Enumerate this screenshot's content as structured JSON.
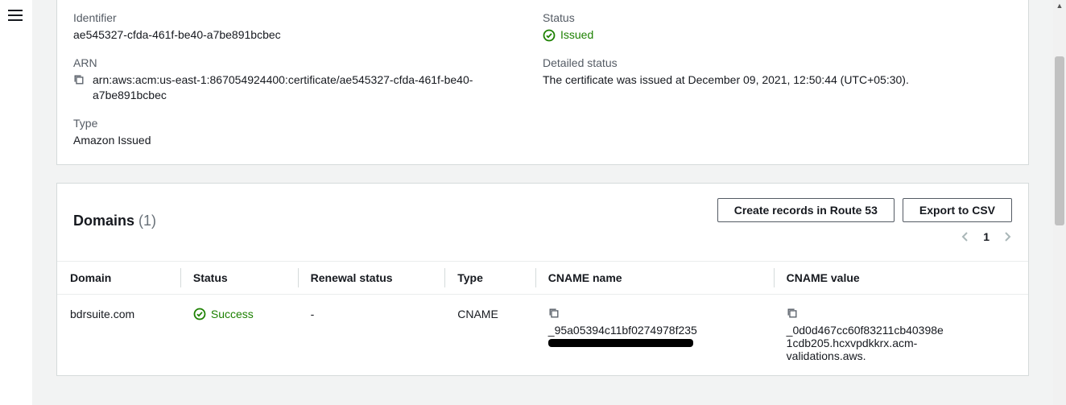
{
  "details": {
    "identifier_label": "Identifier",
    "identifier_value": "ae545327-cfda-461f-be40-a7be891bcbec",
    "arn_label": "ARN",
    "arn_value": "arn:aws:acm:us-east-1:867054924400:certificate/ae545327-cfda-461f-be40-a7be891bcbec",
    "type_label": "Type",
    "type_value": "Amazon Issued",
    "status_label": "Status",
    "status_value": "Issued",
    "detailed_status_label": "Detailed status",
    "detailed_status_value": "The certificate was issued at December 09, 2021, 12:50:44 (UTC+05:30)."
  },
  "domains": {
    "title": "Domains",
    "count": "(1)",
    "btn_create": "Create records in Route 53",
    "btn_export": "Export to CSV",
    "page": "1",
    "columns": {
      "domain": "Domain",
      "status": "Status",
      "renewal": "Renewal status",
      "type": "Type",
      "cname_name": "CNAME name",
      "cname_value": "CNAME value"
    },
    "row": {
      "domain": "bdrsuite.com",
      "status": "Success",
      "renewal": "-",
      "type": "CNAME",
      "cname_name": "_95a05394c11bf0274978f235",
      "cname_value": "_0d0d467cc60f83211cb40398e1cdb205.hcxvpdkkrx.acm-validations.aws."
    }
  }
}
